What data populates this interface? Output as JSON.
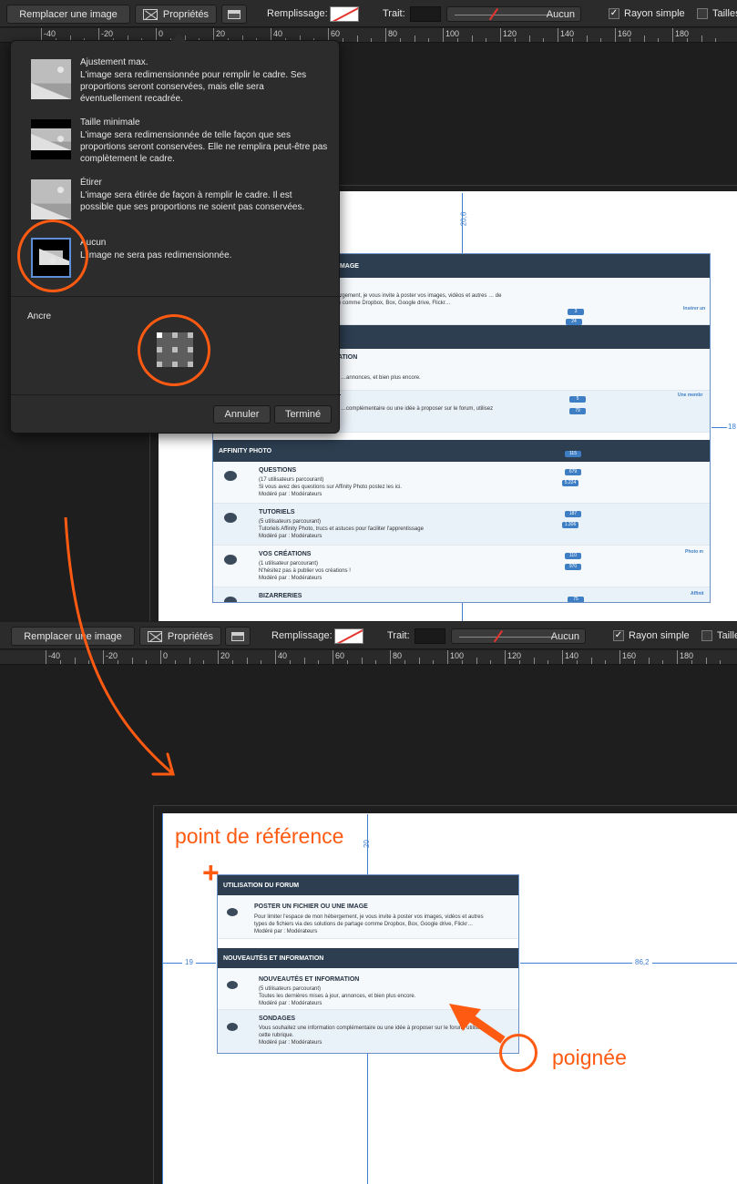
{
  "toolbar": {
    "replace_image": "Remplacer une image",
    "properties": "Propriétés",
    "fill_label": "Remplissage:",
    "stroke_label": "Trait:",
    "stroke_value": "Aucun",
    "simple_radius": "Rayon simple",
    "size_label": "Tailles"
  },
  "ruler": {
    "labels": [
      "-40",
      "-20",
      "0",
      "20",
      "40",
      "60",
      "80",
      "100",
      "120",
      "140",
      "160",
      "180"
    ]
  },
  "popover": {
    "options": [
      {
        "title": "Ajustement max.",
        "desc": "L'image sera redimensionnée pour remplir le cadre. Ses proportions seront conservées, mais elle sera éventuellement recadrée."
      },
      {
        "title": "Taille minimale",
        "desc": "L'image sera redimensionnée de telle façon que ses proportions seront conservées. Elle ne remplira peut-être pas complètement le cadre."
      },
      {
        "title": "Étirer",
        "desc": "L'image sera étirée de façon à remplir le cadre. Il est possible que ses proportions ne soient pas conservées."
      },
      {
        "title": "Aucun",
        "desc": "L'image ne sera pas redimensionnée."
      }
    ],
    "anchor_label": "Ancre",
    "cancel": "Annuler",
    "done": "Terminé"
  },
  "top_forum": {
    "sections": [
      {
        "head": "…IMAGE",
        "desc": "…hébergement, je vous invite à poster vos images, vidéos et autres … de partage comme Dropbox, Box, Google drive, Flickr…",
        "pill1": "3",
        "pill2": "24",
        "side": "Insérer un"
      },
      {
        "head": "…ATION",
        "desc": "…annonces, et bien plus encore.",
        "pill1": "115",
        "pill2": "1.055"
      },
      {
        "head": "",
        "desc": "…complémentaire ou une idée à proposer sur le forum, utilisez",
        "pill1": "5",
        "pill2": "79",
        "side": "Une membr"
      }
    ],
    "affinity_head": "AFFINITY PHOTO",
    "rows": [
      {
        "title": "QUESTIONS",
        "desc1": "(17 utilisateurs parcourant)",
        "desc2": "Si vous avez des questions sur Affinity Photo postez les ici.",
        "desc3": "Modéré par : Modérateurs",
        "pill1": "679",
        "pill2": "5.224"
      },
      {
        "title": "TUTORIELS",
        "desc1": "(5 utilisateurs parcourant)",
        "desc2": "Tutoriels Affinity Photo, trucs et astuces pour faciliter l'apprentissage",
        "desc3": "Modéré par : Modérateurs",
        "pill1": "187",
        "pill2": "1.306"
      },
      {
        "title": "VOS CRÉATIONS",
        "desc1": "(1 utilisateur parcourant)",
        "desc2": "N'hésitez pas à publier vos créations !",
        "desc3": "Modéré par : Modérateurs",
        "pill1": "110",
        "pill2": "970",
        "side": "Photo m"
      },
      {
        "title": "BIZARRERIES",
        "pill1": "75",
        "side": "Affinit"
      }
    ],
    "measure_top": "20,6",
    "measure_right": "18"
  },
  "bottom_forum": {
    "head1": "UTILISATION DU FORUM",
    "row1_title": "POSTER UN FICHIER OU UNE IMAGE",
    "row1_desc1": "Pour limiter l'espace de mon hébergement, je vous invite à poster vos images, vidéos et autres",
    "row1_desc2": "types de fichiers via des solutions de partage comme Dropbox, Box, Google drive, Flickr…",
    "row1_desc3": "Modéré par : Modérateurs",
    "head2": "NOUVEAUTÉS ET INFORMATION",
    "row2_title": "NOUVEAUTÉS ET INFORMATION",
    "row2_desc1": "(5 utilisateurs parcourant)",
    "row2_desc2": "Toutes les dernières mises à jour, annonces, et bien plus encore.",
    "row2_desc3": "Modéré par : Modérateurs",
    "row3_title": "SONDAGES",
    "row3_desc1": "Vous souhaitez une information complémentaire ou une idée à proposer sur le forum, utilisez",
    "row3_desc2": "cette rubrique.",
    "row3_desc3": "Modéré par : Modérateurs",
    "measure_left": "19",
    "measure_right": "86,2",
    "measure_top": "20"
  },
  "annotations": {
    "reference_point": "point de référence",
    "handle": "poignée"
  },
  "colors": {
    "accent_orange": "#ff5a12",
    "guide_blue": "#3f7fd1",
    "forum_header": "#2c3e50"
  }
}
